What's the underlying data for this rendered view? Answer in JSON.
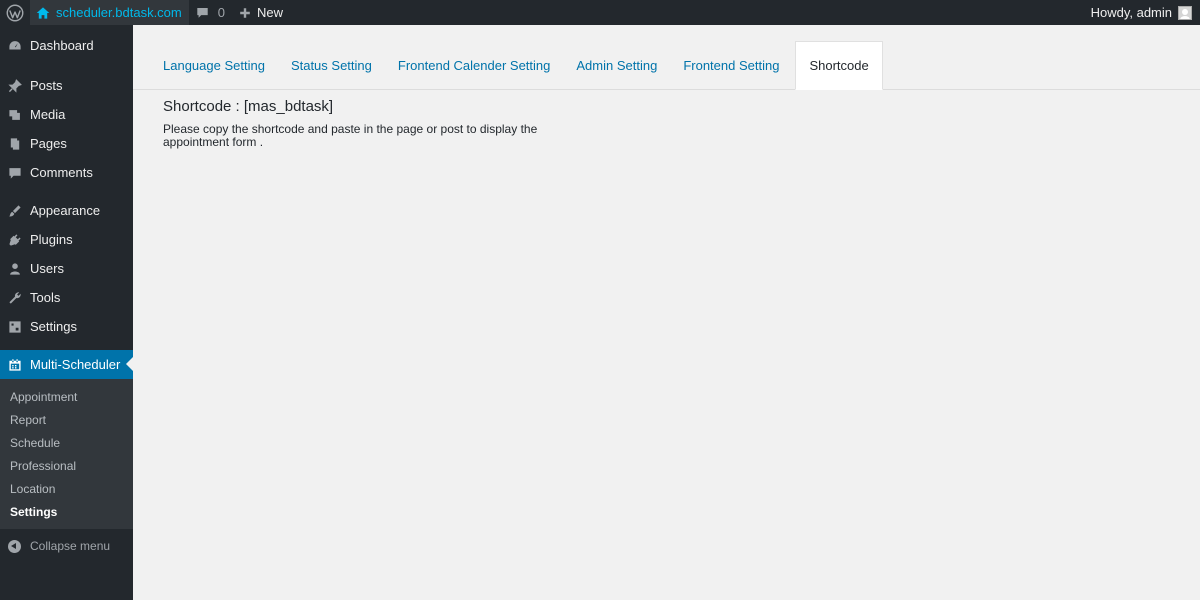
{
  "admin_bar": {
    "wp_logo_icon": "wordpress-logo-icon",
    "site_name": "scheduler.bdtask.com",
    "comments_count": "0",
    "new_label": "New",
    "greeting": "Howdy, admin"
  },
  "sidebar": {
    "items": [
      {
        "label": "Dashboard",
        "icon": "dashboard-icon"
      },
      {
        "label": "Posts",
        "icon": "pin-icon"
      },
      {
        "label": "Media",
        "icon": "media-icon"
      },
      {
        "label": "Pages",
        "icon": "pages-icon"
      },
      {
        "label": "Comments",
        "icon": "comment-icon"
      },
      {
        "label": "Appearance",
        "icon": "brush-icon"
      },
      {
        "label": "Plugins",
        "icon": "plug-icon"
      },
      {
        "label": "Users",
        "icon": "user-icon"
      },
      {
        "label": "Tools",
        "icon": "wrench-icon"
      },
      {
        "label": "Settings",
        "icon": "settings-icon"
      }
    ],
    "current": {
      "label": "Multi-Scheduler",
      "icon": "calendar-icon"
    },
    "submenu": [
      "Appointment",
      "Report",
      "Schedule",
      "Professional",
      "Location",
      "Settings"
    ],
    "submenu_current": "Settings",
    "collapse_label": "Collapse menu"
  },
  "tabs": [
    {
      "label": "Language Setting",
      "active": false
    },
    {
      "label": "Status Setting",
      "active": false
    },
    {
      "label": "Frontend Calender Setting",
      "active": false
    },
    {
      "label": "Admin Setting",
      "active": false
    },
    {
      "label": "Frontend Setting",
      "active": false
    },
    {
      "label": "Shortcode",
      "active": true
    }
  ],
  "shortcode": {
    "title": "Shortcode : [mas_bdtask]",
    "description": "Please copy the shortcode and paste in the page or post to display the appointment form ."
  },
  "colors": {
    "admin_bar": "#23282d",
    "accent": "#0073aa",
    "link": "#00b9eb",
    "background": "#f1f1f1"
  }
}
